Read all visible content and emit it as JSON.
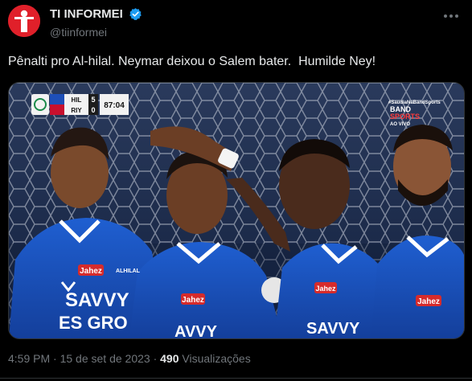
{
  "account": {
    "display_name": "TI INFORMEI",
    "handle": "@tiinformei",
    "avatar_icon": "person-silhouette-icon",
    "verified_icon": "verified-badge-icon",
    "brand_color": "#e0202a",
    "verified_color": "#1d9bf0"
  },
  "more_icon": "more-options-icon",
  "tweet": {
    "text": "Pênalti pro Al-hilal. Neymar deixou o Salem bater.  Humilde Ney!"
  },
  "media": {
    "scoreboard": {
      "team_home": "HIL",
      "team_away": "RIY",
      "score_home": "5",
      "score_away": "0",
      "clock": "87:04"
    },
    "broadcast": {
      "hashtag": "#SaudiaNaBandSports",
      "channel_top": "BAND",
      "channel_bottom": "SPORTS",
      "live_label": "AO VIVO"
    },
    "jersey_texts": {
      "sponsor_1": "Jahez",
      "sponsor_2": "Jahez",
      "sponsor_3": "Jahez",
      "sponsor_4": "Jahez",
      "club_name": "ALHILAL",
      "big_logo_1": "SAVVY",
      "big_logo_2": "ES GRO",
      "big_logo_3": "AVVY",
      "big_logo_4": "SAVVY"
    }
  },
  "footer": {
    "timestamp": "4:59 PM · 15 de set de 2023 · ",
    "views_count": "490",
    "views_label": " Visualizações"
  }
}
